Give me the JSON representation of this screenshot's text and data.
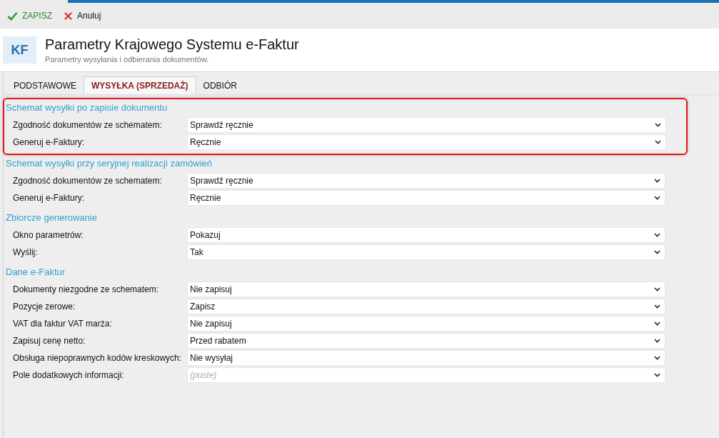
{
  "toolbar": [
    {
      "kind": "save",
      "label": "ZAPISZ"
    },
    {
      "kind": "cancel",
      "label": "Anuluj"
    }
  ],
  "header": {
    "logo": "KF",
    "title": "Parametry Krajowego Systemu e-Faktur",
    "subtitle": "Parametry wysyłania i odbierania dokumentów."
  },
  "tabs": [
    {
      "label": "PODSTAWOWE",
      "selected": false
    },
    {
      "label": "WYSYŁKA (SPRZEDAŻ)",
      "selected": true
    },
    {
      "label": "ODBIÓR",
      "selected": false
    }
  ],
  "sections": [
    {
      "title": "Schemat wysyłki po zapisie dokumentu",
      "highlighted": true,
      "fields": [
        {
          "label": "Zgodność dokumentów ze schematem:",
          "value": "Sprawdź ręcznie"
        },
        {
          "label": "Generuj e-Faktury:",
          "value": "Ręcznie"
        }
      ]
    },
    {
      "title": "Schemat wysyłki przy seryjnej realizacji zamówień",
      "highlighted": false,
      "fields": [
        {
          "label": "Zgodność dokumentów ze schematem:",
          "value": "Sprawdź ręcznie"
        },
        {
          "label": "Generuj e-Faktury:",
          "value": "Ręcznie"
        }
      ]
    },
    {
      "title": "Zbiorcze generowanie",
      "highlighted": false,
      "fields": [
        {
          "label": "Okno parametrów:",
          "value": "Pokazuj"
        },
        {
          "label": "Wyślij:",
          "value": "Tak"
        }
      ]
    },
    {
      "title": "Dane e-Faktur",
      "highlighted": false,
      "fields": [
        {
          "label": "Dokumenty niezgodne ze schematem:",
          "value": "Nie zapisuj"
        },
        {
          "label": "Pozycje zerowe:",
          "value": "Zapisz"
        },
        {
          "label": "VAT dla faktur VAT marża:",
          "value": "Nie zapisuj"
        },
        {
          "label": "Zapisuj cenę netto:",
          "value": "Przed rabatem"
        },
        {
          "label": "Obsługa niepoprawnych kodów kreskowych:",
          "value": "Nie wysyłaj"
        },
        {
          "label": "Pole dodatkowych informacji:",
          "placeholder": "(puste)"
        }
      ]
    }
  ]
}
